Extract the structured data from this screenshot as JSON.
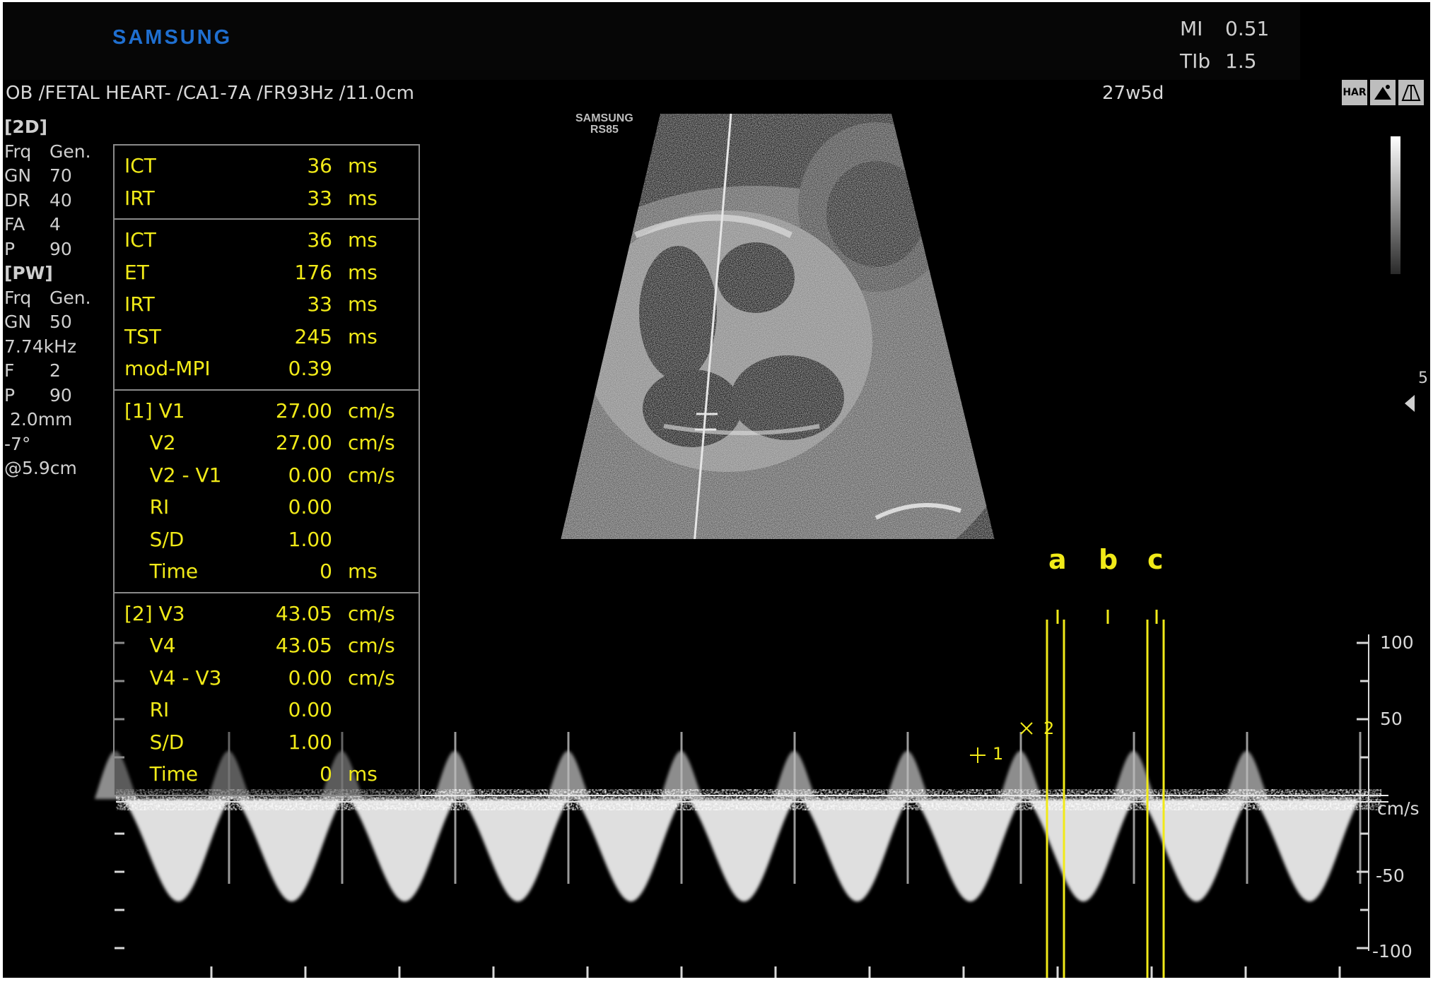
{
  "header": {
    "brand": "SAMSUNG",
    "mi_label": "MI",
    "mi_value": "0.51",
    "tib_label": "TIb",
    "tib_value": "1.5"
  },
  "info_line": "OB /FETAL HEART- /CA1-7A /FR93Hz /11.0cm",
  "gestational_age": "27w5d",
  "mode_icons": [
    "HAR",
    "probe-icon",
    "sector-icon"
  ],
  "params_2d": {
    "heading": "[2D]",
    "rows": [
      {
        "k": "Frq",
        "v": "Gen."
      },
      {
        "k": "GN",
        "v": "70"
      },
      {
        "k": "DR",
        "v": "40"
      },
      {
        "k": "FA",
        "v": "4"
      },
      {
        "k": "P",
        "v": "90"
      }
    ]
  },
  "params_pw": {
    "heading": "[PW]",
    "rows": [
      {
        "k": "Frq",
        "v": "Gen."
      },
      {
        "k": "GN",
        "v": "50"
      },
      {
        "k": "7.74kHz",
        "v": ""
      },
      {
        "k": "F",
        "v": "2"
      },
      {
        "k": "P",
        "v": "90"
      },
      {
        "k": " 2.0mm",
        "v": ""
      },
      {
        "k": "-7°",
        "v": ""
      },
      {
        "k": "@5.9cm",
        "v": ""
      }
    ]
  },
  "measurements": {
    "section1": [
      {
        "label": "ICT",
        "value": "36",
        "unit": "ms"
      },
      {
        "label": "IRT",
        "value": "33",
        "unit": "ms"
      }
    ],
    "section2": [
      {
        "label": "ICT",
        "value": "36",
        "unit": "ms"
      },
      {
        "label": "ET",
        "value": "176",
        "unit": "ms"
      },
      {
        "label": "IRT",
        "value": "33",
        "unit": "ms"
      },
      {
        "label": "TST",
        "value": "245",
        "unit": "ms"
      },
      {
        "label": "mod-MPI",
        "value": "0.39",
        "unit": ""
      }
    ],
    "section3": [
      {
        "label": "[1] V1",
        "value": "27.00",
        "unit": "cm/s"
      },
      {
        "label": "    V2",
        "value": "27.00",
        "unit": "cm/s"
      },
      {
        "label": "    V2 - V1",
        "value": "0.00",
        "unit": "cm/s"
      },
      {
        "label": "    RI",
        "value": "0.00",
        "unit": ""
      },
      {
        "label": "    S/D",
        "value": "1.00",
        "unit": ""
      },
      {
        "label": "    Time",
        "value": "0",
        "unit": "ms"
      }
    ],
    "section4": [
      {
        "label": "[2] V3",
        "value": "43.05",
        "unit": "cm/s"
      },
      {
        "label": "    V4",
        "value": "43.05",
        "unit": "cm/s"
      },
      {
        "label": "    V4 - V3",
        "value": "0.00",
        "unit": "cm/s"
      },
      {
        "label": "    RI",
        "value": "0.00",
        "unit": ""
      },
      {
        "label": "    S/D",
        "value": "1.00",
        "unit": ""
      },
      {
        "label": "    Time",
        "value": "0",
        "unit": "ms"
      }
    ]
  },
  "image_vendor": {
    "line1": "SAMSUNG",
    "line2": "RS85"
  },
  "depth_marker": "5",
  "velocity_scale": {
    "unit": "cm/s",
    "labels": [
      "100",
      "50",
      "-50",
      "-100"
    ]
  },
  "annotations": {
    "a": "a",
    "b": "b",
    "c": "c",
    "cursor1": "1",
    "cursor2": "2"
  },
  "colors": {
    "background": "#000000",
    "measurement_text": "#f1ea18",
    "brand": "#1f6fd0",
    "overlay_text": "#d8d8d8"
  }
}
